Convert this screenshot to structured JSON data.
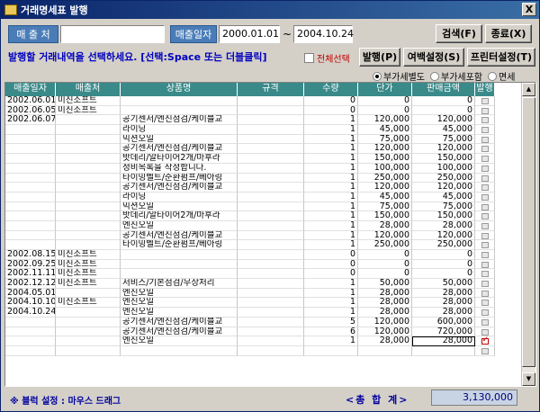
{
  "window": {
    "title": "거래명세표 발행",
    "close_label": "X"
  },
  "filter": {
    "customer_label": "매 출 처",
    "customer_value": "",
    "date_label": "매출일자",
    "date_from": "2000.01.01",
    "date_sep": "~",
    "date_to": "2004.10.24",
    "search_label": "검색(F)",
    "exit_label": "종료(X)"
  },
  "toolbar": {
    "instruction": "발행할 거래내역을 선택하세요. [선택:Space 또는 더블클릭]",
    "select_all_label": "전체선택",
    "issue_label": "발행(P)",
    "margin_label": "여백설정(S)",
    "printer_label": "프린터설정(T)"
  },
  "tax_options": {
    "items": [
      "부가세별도",
      "부가세포함",
      "면세"
    ],
    "selected": "부가세별도"
  },
  "table": {
    "headers": [
      "매출일자",
      "매출처",
      "상품명",
      "규격",
      "수량",
      "단가",
      "판매금액",
      "발행"
    ],
    "rows": [
      {
        "date": "2002.06.01",
        "customer": "미진소프트",
        "product": "",
        "spec": "",
        "qty": "0",
        "price": "0",
        "amount": "0",
        "issued": false
      },
      {
        "date": "2002.06.05",
        "customer": "미진소프트",
        "product": "",
        "spec": "",
        "qty": "0",
        "price": "0",
        "amount": "0",
        "issued": false
      },
      {
        "date": "2002.06.07",
        "customer": "",
        "product": "공기센서/엔진점검/케이블교",
        "spec": "",
        "qty": "1",
        "price": "120,000",
        "amount": "120,000",
        "issued": false
      },
      {
        "date": "",
        "customer": "",
        "product": "라이닝",
        "spec": "",
        "qty": "1",
        "price": "45,000",
        "amount": "45,000",
        "issued": false
      },
      {
        "date": "",
        "customer": "",
        "product": "믹션오일",
        "spec": "",
        "qty": "1",
        "price": "75,000",
        "amount": "75,000",
        "issued": false
      },
      {
        "date": "",
        "customer": "",
        "product": "공기센서/엔진점검/케이블교",
        "spec": "",
        "qty": "1",
        "price": "120,000",
        "amount": "120,000",
        "issued": false
      },
      {
        "date": "",
        "customer": "",
        "product": "밧데리/알타이어2개/마후라",
        "spec": "",
        "qty": "1",
        "price": "150,000",
        "amount": "150,000",
        "issued": false
      },
      {
        "date": "",
        "customer": "",
        "product": "정비목록을 작성합니다.",
        "spec": "",
        "qty": "1",
        "price": "100,000",
        "amount": "100,000",
        "issued": false
      },
      {
        "date": "",
        "customer": "",
        "product": "타이밍벨트/순환펌프/베아링",
        "spec": "",
        "qty": "1",
        "price": "250,000",
        "amount": "250,000",
        "issued": false
      },
      {
        "date": "",
        "customer": "",
        "product": "공기센서/엔진점검/케이블교",
        "spec": "",
        "qty": "1",
        "price": "120,000",
        "amount": "120,000",
        "issued": false
      },
      {
        "date": "",
        "customer": "",
        "product": "라이닝",
        "spec": "",
        "qty": "1",
        "price": "45,000",
        "amount": "45,000",
        "issued": false
      },
      {
        "date": "",
        "customer": "",
        "product": "믹션오일",
        "spec": "",
        "qty": "1",
        "price": "75,000",
        "amount": "75,000",
        "issued": false
      },
      {
        "date": "",
        "customer": "",
        "product": "밧데리/알타이어2개/마후라",
        "spec": "",
        "qty": "1",
        "price": "150,000",
        "amount": "150,000",
        "issued": false
      },
      {
        "date": "",
        "customer": "",
        "product": "엔진오일",
        "spec": "",
        "qty": "1",
        "price": "28,000",
        "amount": "28,000",
        "issued": false
      },
      {
        "date": "",
        "customer": "",
        "product": "공기센서/엔진점검/케이블교",
        "spec": "",
        "qty": "1",
        "price": "120,000",
        "amount": "120,000",
        "issued": false
      },
      {
        "date": "",
        "customer": "",
        "product": "타이밍벨트/순환펌프/베아링",
        "spec": "",
        "qty": "1",
        "price": "250,000",
        "amount": "250,000",
        "issued": false
      },
      {
        "date": "2002.08.15",
        "customer": "미진소프트",
        "product": "",
        "spec": "",
        "qty": "0",
        "price": "0",
        "amount": "0",
        "issued": false
      },
      {
        "date": "2002.09.25",
        "customer": "미진소프트",
        "product": "",
        "spec": "",
        "qty": "0",
        "price": "0",
        "amount": "0",
        "issued": false
      },
      {
        "date": "2002.11.11",
        "customer": "미진소프트",
        "product": "",
        "spec": "",
        "qty": "0",
        "price": "0",
        "amount": "0",
        "issued": false
      },
      {
        "date": "2002.12.12",
        "customer": "미진소프트",
        "product": "서비스/기본점검/무상처리",
        "spec": "",
        "qty": "1",
        "price": "50,000",
        "amount": "50,000",
        "issued": false
      },
      {
        "date": "2004.05.01",
        "customer": "",
        "product": "엔진오일",
        "spec": "",
        "qty": "1",
        "price": "28,000",
        "amount": "28,000",
        "issued": false
      },
      {
        "date": "2004.10.10",
        "customer": "미진소프트",
        "product": "엔진오일",
        "spec": "",
        "qty": "1",
        "price": "28,000",
        "amount": "28,000",
        "issued": false
      },
      {
        "date": "2004.10.24",
        "customer": "",
        "product": "엔진오일",
        "spec": "",
        "qty": "1",
        "price": "28,000",
        "amount": "28,000",
        "issued": false
      },
      {
        "date": "",
        "customer": "",
        "product": "공기센서/엔진점검/케이블교",
        "spec": "",
        "qty": "5",
        "price": "120,000",
        "amount": "600,000",
        "issued": false
      },
      {
        "date": "",
        "customer": "",
        "product": "공기센서/엔진점검/케이블교",
        "spec": "",
        "qty": "6",
        "price": "120,000",
        "amount": "720,000",
        "issued": false
      },
      {
        "date": "",
        "customer": "",
        "product": "엔진오일",
        "spec": "",
        "qty": "1",
        "price": "28,000",
        "amount": "28,000",
        "issued": true
      },
      {
        "date": "",
        "customer": "",
        "product": "",
        "spec": "",
        "qty": "",
        "price": "",
        "amount": "",
        "issued": false
      }
    ]
  },
  "footer": {
    "note": "※ 블럭 설정 : 마우스 드래그",
    "total_label": "<총 합 계>",
    "total_value": "3,130,000"
  }
}
